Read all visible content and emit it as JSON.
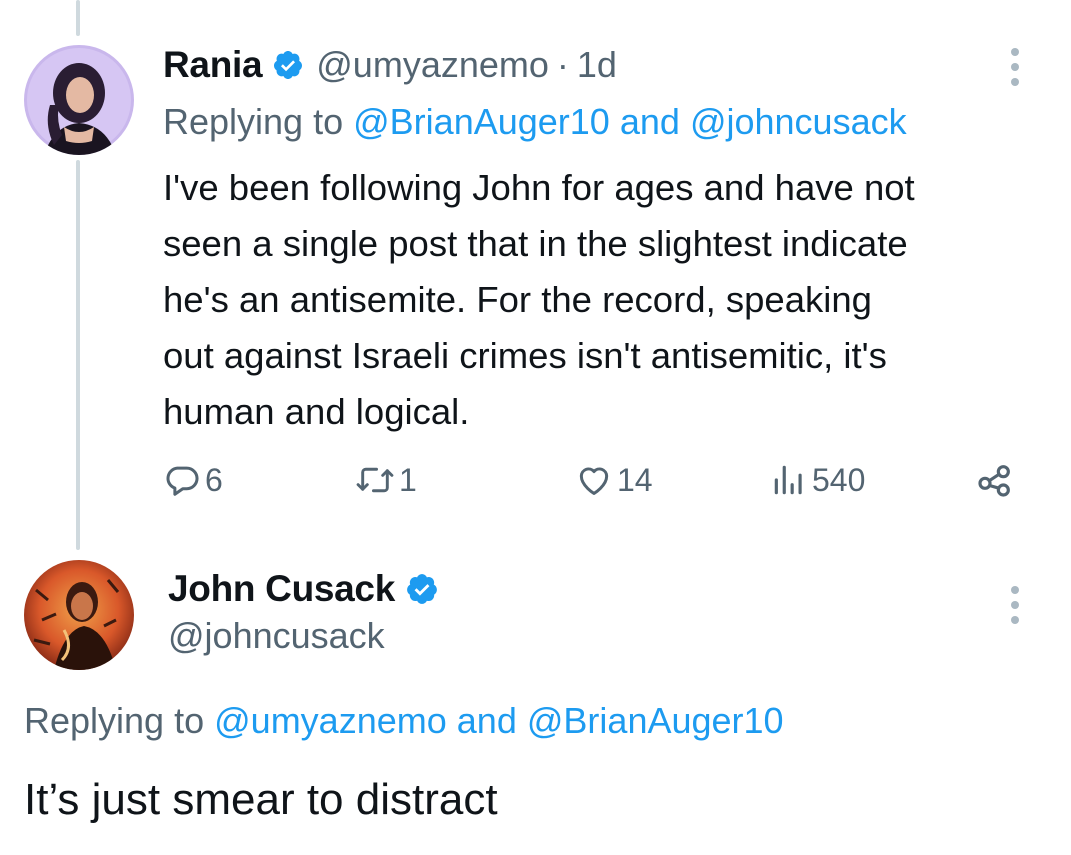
{
  "reply_tweet": {
    "author": {
      "name": "Rania",
      "handle": "@umyaznemo",
      "verified": true
    },
    "separator": "·",
    "time": "1d",
    "replying_prefix": "Replying to",
    "replying_mentions": [
      "@BrianAuger10",
      "@johncusack"
    ],
    "replying_joiner": "and",
    "text_lines": [
      "I've been following John for ages and have not",
      "seen a single post that in the slightest indicate",
      "he's an antisemite. For the record, speaking",
      "out against Israeli crimes isn't antisemitic, it's",
      "human and logical."
    ],
    "actions": {
      "reply_icon": "reply-icon",
      "replies": "6",
      "retweet_icon": "retweet-icon",
      "retweets": "1",
      "like_icon": "heart-icon",
      "likes": "14",
      "views_icon": "views-icon",
      "views": "540",
      "share_icon": "share-icon"
    }
  },
  "main_tweet": {
    "author": {
      "name": "John Cusack",
      "handle": "@johncusack",
      "verified": true
    },
    "replying_prefix": "Replying to",
    "replying_mentions": [
      "@umyaznemo",
      "@BrianAuger10"
    ],
    "replying_joiner": "and",
    "text": "It’s just smear to distract"
  },
  "colors": {
    "text_primary": "#0f1419",
    "text_secondary": "#536471",
    "accent": "#1d9bf0",
    "thread_line": "#cfd9de"
  }
}
